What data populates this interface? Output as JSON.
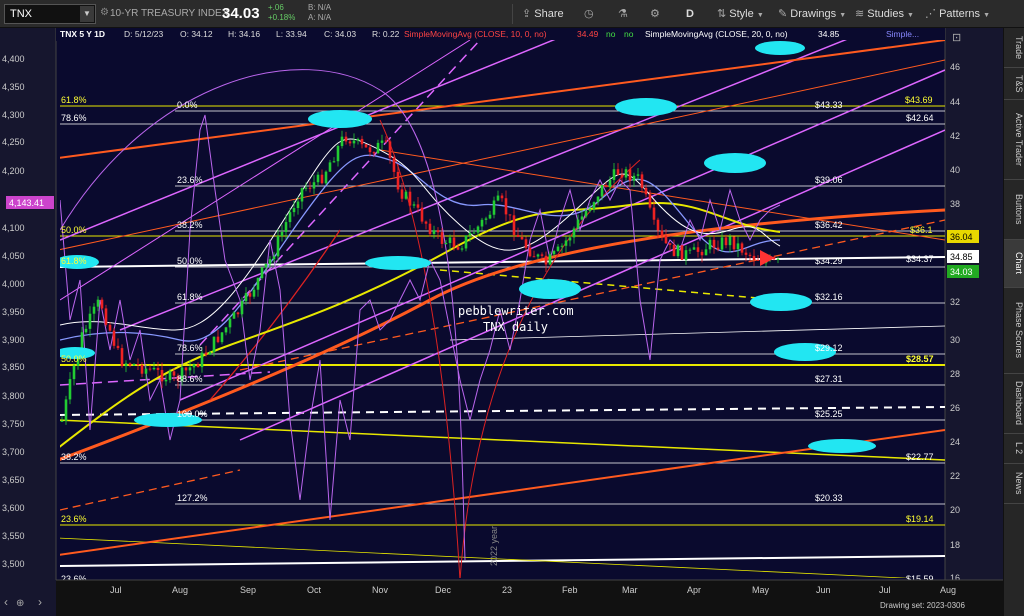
{
  "toolbar": {
    "symbol": "TNX",
    "description": "10-YR TREASURY INDEX",
    "price": "34.03",
    "change": "+.06",
    "change_pct": "+0.18%",
    "bid": "B: N/A",
    "ask": "A: N/A",
    "share": "Share",
    "period": "D",
    "style": "Style",
    "drawings": "Drawings",
    "studies": "Studies",
    "patterns": "Patterns"
  },
  "chart_header": {
    "title": "TNX 5 Y 1D",
    "date": "D: 5/12/23",
    "open": "O: 34.12",
    "high": "H: 34.16",
    "low": "L: 33.94",
    "close": "C: 34.03",
    "range": "R: 0.22",
    "sma10_label": "SimpleMovingAvg (CLOSE, 10, 0, no)",
    "sma10_value": "34.49",
    "sma10_flag1": "no",
    "sma10_flag2": "no",
    "sma20_label": "SimpleMovingAvg (CLOSE, 20, 0, no)",
    "sma20_value": "34.85",
    "more": "Simple..."
  },
  "left_axis": [
    "4,400",
    "4,350",
    "4,300",
    "4,250",
    "4,200",
    "4,150",
    "4,100",
    "4,050",
    "4,000",
    "3,950",
    "3,900",
    "3,850",
    "3,800",
    "3,750",
    "3,700",
    "3,650",
    "3,600",
    "3,550",
    "3,500"
  ],
  "left_marker": "4,143.41",
  "right_axis": [
    "46",
    "44",
    "42",
    "40",
    "38",
    "36",
    "34",
    "32",
    "30",
    "28",
    "26",
    "24",
    "22",
    "20",
    "18",
    "16"
  ],
  "price_tags": {
    "sma20": "34.85",
    "current": "34.03",
    "level": "36.04"
  },
  "x_axis": [
    "Jul",
    "Aug",
    "Sep",
    "Oct",
    "Nov",
    "Dec",
    "23",
    "Feb",
    "Mar",
    "Apr",
    "May",
    "Jun",
    "Jul",
    "Aug"
  ],
  "drawing_set": "Drawing set: 2023-0306",
  "fib_left": [
    "0.0%",
    "23.6%",
    "38.2%",
    "50.0%",
    "61.8%",
    "78.6%",
    "88.6%",
    "100.0%",
    "127.2%"
  ],
  "fib_values": [
    "$43.33",
    "$39.06",
    "$36.42",
    "$34.29",
    "$32.16",
    "$29.12",
    "$27.31",
    "$25.25",
    "$22.77",
    "$20.33"
  ],
  "fib_yellow_left": [
    "61.8%",
    "50.0%",
    "61.8%",
    "50.0%",
    "38.2%",
    "23.6%"
  ],
  "fib_white_left": [
    "78.6%",
    "23.6%"
  ],
  "fib_yellow_right": [
    "$43.69",
    "$36.1",
    "$28.57",
    "$19.14"
  ],
  "fib_white_right": [
    "$42.64",
    "$34.37",
    "$15.59"
  ],
  "watermark": [
    "pebblewriter.com",
    "TNX daily"
  ],
  "annotation": "2022 year",
  "right_tabs": [
    "Trade",
    "T&S",
    "Active Trader",
    "Buttons",
    "Chart",
    "Phase Scores",
    "Dashboard",
    "L 2",
    "News"
  ]
}
